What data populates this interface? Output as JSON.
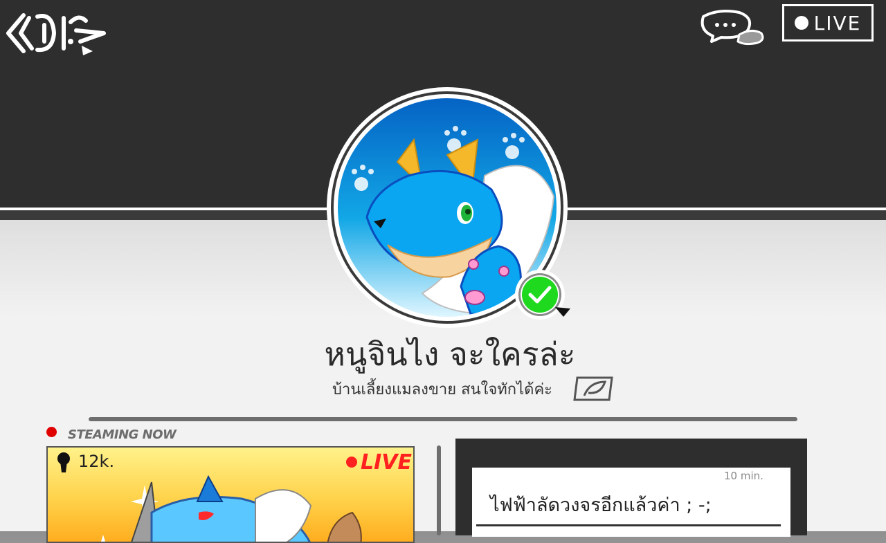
{
  "header": {
    "live_label": "LIVE"
  },
  "profile": {
    "name": "หนูจินไง จะใครล่ะ",
    "bio": "บ้านเลี้ยงแมลงขาย สนใจทักได้ค่ะ"
  },
  "streaming": {
    "section_label": "STEAMING NOW",
    "viewer_count": "12k.",
    "live_label": "LIVE"
  },
  "post": {
    "time": "10 min.",
    "text": "ไฟฟ้าลัดวงจรอีกแล้วค่า ; -;"
  },
  "colors": {
    "header_bg": "#2e2e2e",
    "verified_green": "#1ed91e",
    "live_red": "#ff2020",
    "stream_yellow": "#ffd24a",
    "avatar_blue": "#0a8fe0"
  }
}
